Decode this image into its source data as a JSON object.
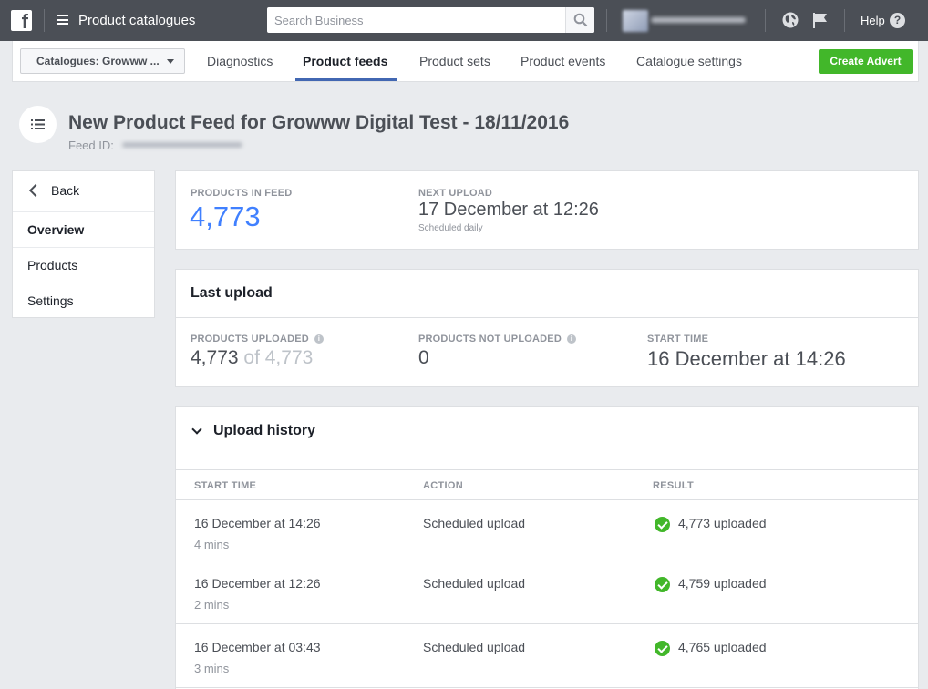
{
  "topbar": {
    "title": "Product catalogues",
    "search_placeholder": "Search Business",
    "help_label": "Help",
    "help_glyph": "?"
  },
  "nav": {
    "catalogue_select": "Catalogues: Growww ...",
    "tabs": [
      {
        "label": "Diagnostics",
        "active": false
      },
      {
        "label": "Product feeds",
        "active": true
      },
      {
        "label": "Product sets",
        "active": false
      },
      {
        "label": "Product events",
        "active": false
      },
      {
        "label": "Catalogue settings",
        "active": false
      }
    ],
    "create_button": "Create Advert"
  },
  "header": {
    "title": "New Product Feed for Growww Digital Test - 18/11/2016",
    "feed_id_label": "Feed ID:"
  },
  "sidebar": {
    "back_label": "Back",
    "items": [
      {
        "label": "Overview",
        "active": true
      },
      {
        "label": "Products",
        "active": false
      },
      {
        "label": "Settings",
        "active": false
      }
    ]
  },
  "summary": {
    "products_in_feed_label": "PRODUCTS IN FEED",
    "products_in_feed_value": "4,773",
    "next_upload_label": "NEXT UPLOAD",
    "next_upload_value": "17 December at 12:26",
    "next_upload_sub": "Scheduled daily"
  },
  "last_upload": {
    "title": "Last upload",
    "uploaded_label": "PRODUCTS UPLOADED",
    "uploaded_value": "4,773",
    "uploaded_of": "of 4,773",
    "not_uploaded_label": "PRODUCTS NOT UPLOADED",
    "not_uploaded_value": "0",
    "start_time_label": "START TIME",
    "start_time_value": "16 December at 14:26"
  },
  "history": {
    "title": "Upload history",
    "columns": [
      "START TIME",
      "ACTION",
      "RESULT"
    ],
    "rows": [
      {
        "start": "16 December at 14:26",
        "duration": "4 mins",
        "action": "Scheduled upload",
        "result": "4,773 uploaded"
      },
      {
        "start": "16 December at 12:26",
        "duration": "2 mins",
        "action": "Scheduled upload",
        "result": "4,759 uploaded"
      },
      {
        "start": "16 December at 03:43",
        "duration": "3 mins",
        "action": "Scheduled upload",
        "result": "4,765 uploaded"
      }
    ]
  },
  "colors": {
    "topbar": "#4b4f56",
    "accent_blue": "#4080ff",
    "tab_underline": "#4267b2",
    "create_green": "#42b72a"
  }
}
